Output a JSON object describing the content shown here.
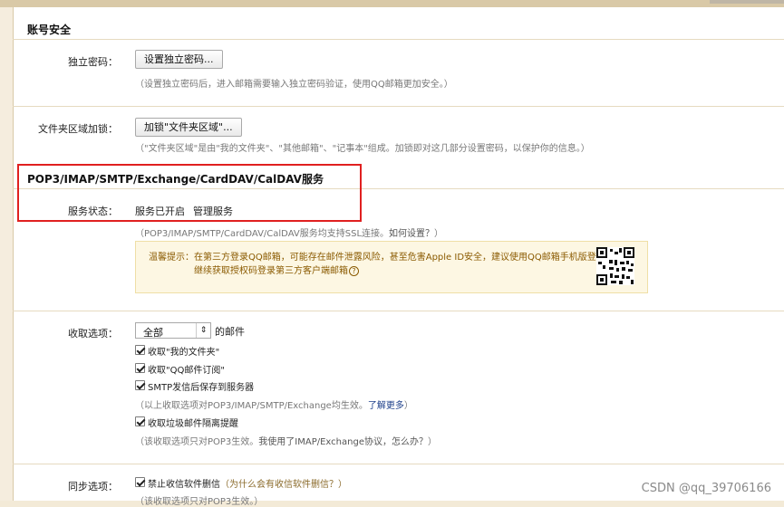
{
  "account_security": {
    "title": "账号安全",
    "independent_password": {
      "label": "独立密码：",
      "button": "设置独立密码...",
      "hint": "（设置独立密码后，进入邮箱需要输入独立密码验证，使用QQ邮箱更加安全。）"
    },
    "folder_lock": {
      "label": "文件夹区域加锁：",
      "button": "加锁\"文件夹区域\"...",
      "hint": "（\"文件夹区域\"是由\"我的文件夹\"、\"其他邮箱\"、\"记事本\"组成。加锁即对这几部分设置密码，以保护你的信息。）"
    }
  },
  "protocols": {
    "title": "POP3/IMAP/SMTP/Exchange/CardDAV/CalDAV服务",
    "service_status": {
      "label": "服务状态：",
      "status": "服务已开启",
      "manage_link": "管理服务"
    },
    "ssl_hint": "（POP3/IMAP/SMTP/CardDAV/CalDAV服务均支持SSL连接。",
    "ssl_link": "如何设置？",
    "ssl_hint_end": "）",
    "warning": {
      "line1": "温馨提示：在第三方登录QQ邮箱，可能存在邮件泄露风险，甚至危害Apple ID安全，建议使用QQ邮箱手机版登录。",
      "line2": "继续获取授权码登录第三方客户端邮箱",
      "help_icon": "question-circle-icon"
    }
  },
  "receive_options": {
    "label": "收取选项：",
    "select_value": "全部",
    "select_suffix": "的邮件",
    "options": [
      {
        "label": "收取\"我的文件夹\"",
        "checked": true
      },
      {
        "label": "收取\"QQ邮件订阅\"",
        "checked": true
      },
      {
        "label": "SMTP发信后保存到服务器",
        "checked": true
      }
    ],
    "note1": "（以上收取选项对POP3/IMAP/SMTP/Exchange均生效。",
    "note1_link": "了解更多",
    "note1_end": "）",
    "spam_option": {
      "label": "收取垃圾邮件隔离提醒",
      "checked": true
    },
    "note2": "（该收取选项只对POP3生效。",
    "note2_link": "我使用了IMAP/Exchange协议，怎么办？",
    "note2_end": "）"
  },
  "sync_options": {
    "label": "同步选项：",
    "option": {
      "label": "禁止收信软件删信",
      "checked": true
    },
    "option_hint": "（",
    "option_link": "为什么会有收信软件删信？",
    "option_hint_end": "）",
    "note": "（该收取选项只对POP3生效。）"
  },
  "watermark": "CSDN @qq_39706166"
}
